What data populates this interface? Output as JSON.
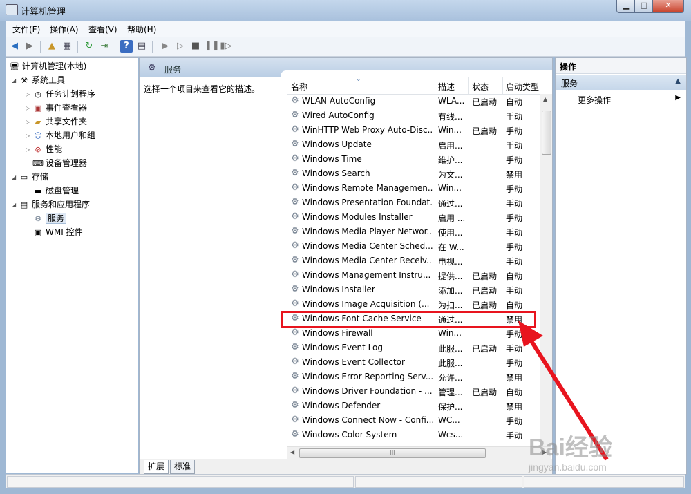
{
  "window": {
    "title": "计算机管理"
  },
  "menu": [
    "文件(F)",
    "操作(A)",
    "查看(V)",
    "帮助(H)"
  ],
  "tree": {
    "root": "计算机管理(本地)",
    "items": [
      {
        "label": "系统工具",
        "icon": "tools-icon"
      },
      {
        "label": "任务计划程序",
        "icon": "clock-icon"
      },
      {
        "label": "事件查看器",
        "icon": "event-viewer-icon"
      },
      {
        "label": "共享文件夹",
        "icon": "shared-folder-icon"
      },
      {
        "label": "本地用户和组",
        "icon": "users-icon"
      },
      {
        "label": "性能",
        "icon": "performance-icon"
      },
      {
        "label": "设备管理器",
        "icon": "device-manager-icon"
      },
      {
        "label": "存储",
        "icon": "storage-icon"
      },
      {
        "label": "磁盘管理",
        "icon": "disk-icon"
      },
      {
        "label": "服务和应用程序",
        "icon": "services-apps-icon"
      },
      {
        "label": "服务",
        "icon": "gear-icon"
      },
      {
        "label": "WMI 控件",
        "icon": "wmi-icon"
      }
    ]
  },
  "center": {
    "title": "服务",
    "description": "选择一个项目来查看它的描述。",
    "columns": {
      "name": "名称",
      "desc": "描述",
      "status": "状态",
      "startup": "启动类型"
    },
    "rows": [
      [
        "WLAN AutoConfig",
        "WLA...",
        "已启动",
        "自动"
      ],
      [
        "Wired AutoConfig",
        "有线...",
        "",
        "手动"
      ],
      [
        "WinHTTP Web Proxy Auto-Disc...",
        "Win...",
        "已启动",
        "手动"
      ],
      [
        "Windows Update",
        "启用...",
        "",
        "手动"
      ],
      [
        "Windows Time",
        "维护...",
        "",
        "手动"
      ],
      [
        "Windows Search",
        "为文...",
        "",
        "禁用"
      ],
      [
        "Windows Remote Managemen...",
        "Win...",
        "",
        "手动"
      ],
      [
        "Windows Presentation Foundat...",
        "通过...",
        "",
        "手动"
      ],
      [
        "Windows Modules Installer",
        "启用 ...",
        "",
        "手动"
      ],
      [
        "Windows Media Player Networ...",
        "使用...",
        "",
        "手动"
      ],
      [
        "Windows Media Center Sched...",
        "在 W...",
        "",
        "手动"
      ],
      [
        "Windows Media Center Receiv...",
        "电视...",
        "",
        "手动"
      ],
      [
        "Windows Management Instru...",
        "提供...",
        "已启动",
        "自动"
      ],
      [
        "Windows Installer",
        "添加...",
        "已启动",
        "手动"
      ],
      [
        "Windows Image Acquisition (...",
        "为扫...",
        "已启动",
        "自动"
      ],
      [
        "Windows Font Cache Service",
        "通过...",
        "",
        "禁用"
      ],
      [
        "Windows Firewall",
        "Win...",
        "",
        "手动"
      ],
      [
        "Windows Event Log",
        "此服...",
        "已启动",
        "手动"
      ],
      [
        "Windows Event Collector",
        "此服...",
        "",
        "手动"
      ],
      [
        "Windows Error Reporting Serv...",
        "允许...",
        "",
        "禁用"
      ],
      [
        "Windows Driver Foundation - ...",
        "管理...",
        "已启动",
        "自动"
      ],
      [
        "Windows Defender",
        "保护...",
        "",
        "禁用"
      ],
      [
        "Windows Connect Now - Confi...",
        "WC...",
        "",
        "手动"
      ],
      [
        "Windows Color System",
        "Wcs...",
        "",
        "手动"
      ]
    ],
    "tabs": [
      "扩展",
      "标准"
    ],
    "scroll_grip": "III"
  },
  "actions": {
    "header": "操作",
    "section": "服务",
    "more": "更多操作"
  },
  "watermark": {
    "line1": "Bai经验",
    "line2": "jingyan.baidu.com"
  },
  "colors": {
    "highlight": "#e8141e",
    "arrow": "#e8141e",
    "chrome": "#9fb8d4"
  }
}
